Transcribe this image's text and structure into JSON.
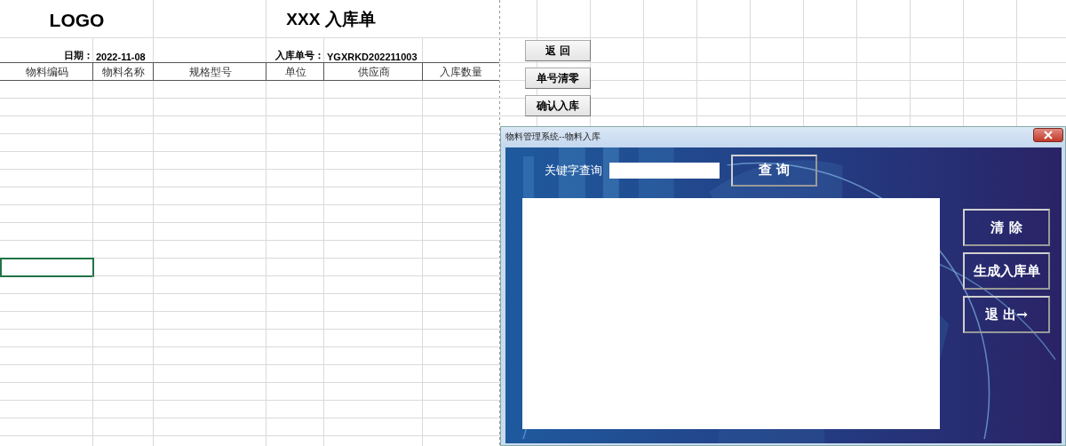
{
  "sheet": {
    "logo": "LOGO",
    "title": "XXX 入库单",
    "date_label": "日期：",
    "date_value": "2022-11-08",
    "number_label": "入库单号：",
    "number_value": "YGXRKD202211003",
    "columns": [
      "物料编码",
      "物料名称",
      "规格型号",
      "单位",
      "供应商",
      "入库数量"
    ],
    "rows": [
      {
        "selected": false
      },
      {
        "selected": false
      },
      {
        "selected": false
      },
      {
        "selected": false
      },
      {
        "selected": false
      },
      {
        "selected": false
      },
      {
        "selected": false
      },
      {
        "selected": false
      },
      {
        "selected": false
      },
      {
        "selected": false
      },
      {
        "selected": true
      },
      {
        "selected": false
      },
      {
        "selected": false
      },
      {
        "selected": false
      },
      {
        "selected": false
      },
      {
        "selected": false
      },
      {
        "selected": false
      },
      {
        "selected": false
      },
      {
        "selected": false
      },
      {
        "selected": false
      },
      {
        "selected": false
      }
    ]
  },
  "sheet_buttons": [
    "返 回",
    "单号清零",
    "确认入库"
  ],
  "dialog": {
    "title": "物料管理系统--物料入库",
    "search_label": "关键字查询",
    "search_button": "查 询",
    "side_buttons": [
      "清 除",
      "生成入库单",
      "退 出→"
    ]
  }
}
